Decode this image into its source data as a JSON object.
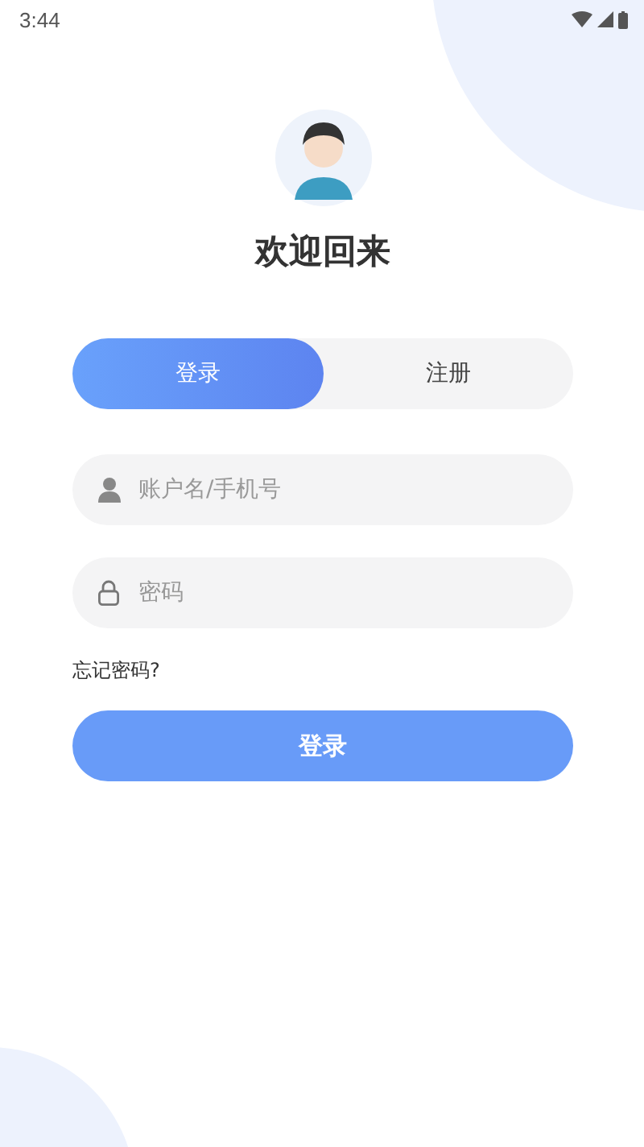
{
  "status_bar": {
    "time": "3:44"
  },
  "title": "欢迎回来",
  "tabs": [
    {
      "label": "登录",
      "selected": true
    },
    {
      "label": "注册",
      "selected": false
    }
  ],
  "fields": [
    {
      "kind": "user",
      "placeholder": "账户名/手机号"
    },
    {
      "kind": "password",
      "placeholder": "密码"
    }
  ],
  "forgot_link": "忘记密码?",
  "submit_button": "登录"
}
